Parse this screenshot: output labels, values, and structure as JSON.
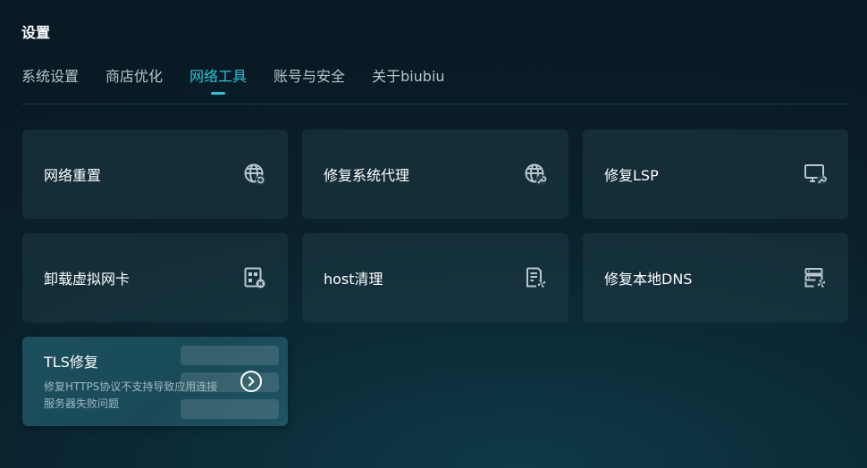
{
  "header": {
    "title": "设置"
  },
  "tabs": [
    {
      "label": "系统设置",
      "active": false
    },
    {
      "label": "商店优化",
      "active": false
    },
    {
      "label": "网络工具",
      "active": true
    },
    {
      "label": "账号与安全",
      "active": false
    },
    {
      "label": "关于biubiu",
      "active": false
    }
  ],
  "tools": [
    {
      "label": "网络重置",
      "icon": "globe-refresh-icon"
    },
    {
      "label": "修复系统代理",
      "icon": "globe-wrench-icon"
    },
    {
      "label": "修复LSP",
      "icon": "monitor-wrench-icon"
    },
    {
      "label": "卸载虚拟网卡",
      "icon": "network-card-remove-icon"
    },
    {
      "label": "host清理",
      "icon": "document-fan-icon"
    },
    {
      "label": "修复本地DNS",
      "icon": "server-fan-icon"
    }
  ],
  "featured": {
    "title": "TLS修复",
    "description": "修复HTTPS协议不支持导致应用连接服务器失败问题",
    "icon": "chevron-right-circle-icon"
  },
  "colors": {
    "accent": "#26c6da",
    "card_bg": "#1e3a46",
    "text_secondary": "#b7c4cc"
  }
}
